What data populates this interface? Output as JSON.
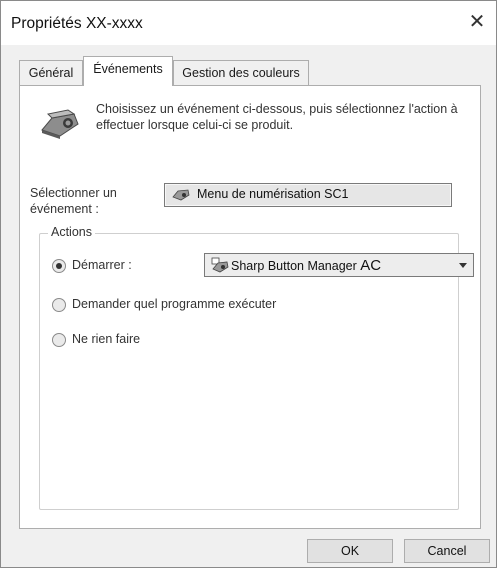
{
  "window": {
    "title": "Propriétés XX-xxxx",
    "close_icon": "close-icon"
  },
  "tabs": [
    {
      "label": "Général"
    },
    {
      "label": "Événements"
    },
    {
      "label": "Gestion des couleurs"
    }
  ],
  "active_tab": "Événements",
  "intro": {
    "icon": "scanner-camera-icon",
    "text": "Choisissez un événement ci-dessous, puis sélectionnez l'action à effectuer lorsque celui-ci se produit."
  },
  "event": {
    "label": "Sélectionner un événement :",
    "value": "Menu de numérisation SC1",
    "icon": "scanner-icon"
  },
  "actions": {
    "title": "Actions",
    "options": [
      {
        "label": "Démarrer :",
        "checked": true
      },
      {
        "label": "Demander quel programme exécuter",
        "checked": false
      },
      {
        "label": "Ne rien faire",
        "checked": false
      }
    ],
    "program_select": {
      "value_main": "Sharp Button Manager ",
      "value_suffix": "AC",
      "icon": "sharp-program-icon"
    }
  },
  "buttons": {
    "ok": "OK",
    "cancel": "Cancel"
  }
}
